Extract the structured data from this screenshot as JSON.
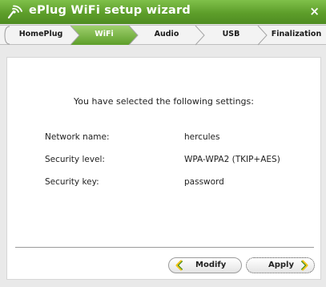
{
  "window": {
    "title": "ePlug WiFi setup wizard",
    "close_glyph": "×",
    "logo_icon": "eplug-logo-icon"
  },
  "steps": [
    {
      "label": "HomePlug",
      "active": false
    },
    {
      "label": "WiFi",
      "active": true
    },
    {
      "label": "Audio",
      "active": false
    },
    {
      "label": "USB",
      "active": false
    },
    {
      "label": "Finalization",
      "active": false
    }
  ],
  "summary": {
    "heading": "You have selected the following settings:",
    "rows": [
      {
        "label": "Network name:",
        "value": "hercules"
      },
      {
        "label": "Security level:",
        "value": "WPA-WPA2 (TKIP+AES)"
      },
      {
        "label": "Security key:",
        "value": "password"
      }
    ]
  },
  "buttons": {
    "modify": "Modify",
    "apply": "Apply"
  },
  "colors": {
    "accent_green": "#5d9e2a",
    "active_step": "#6fb33a"
  }
}
